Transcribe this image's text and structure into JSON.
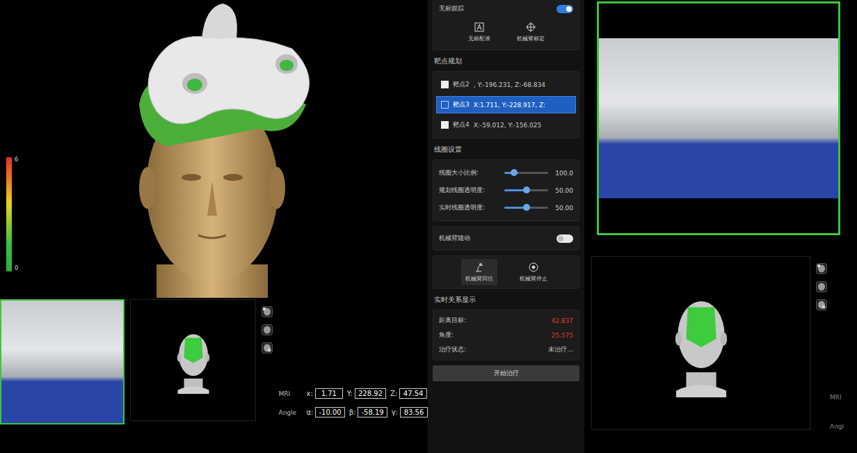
{
  "legend": {
    "max": "6",
    "min": "0"
  },
  "camera_left": {
    "active": true
  },
  "coords": [
    {
      "label": "MRI",
      "fields": [
        {
          "axis": "x:",
          "value": "1.71"
        },
        {
          "axis": "Y:",
          "value": "228.92"
        },
        {
          "axis": "Z:",
          "value": "47.54"
        }
      ]
    },
    {
      "label": "Angle",
      "fields": [
        {
          "axis": "α:",
          "value": "-10.00"
        },
        {
          "axis": "β:",
          "value": "-58.19"
        },
        {
          "axis": "γ:",
          "value": "83.56"
        }
      ]
    }
  ],
  "panel": {
    "tracking": {
      "label": "无标跟踪",
      "on": true
    },
    "tracking_buttons": [
      "无标配准",
      "机械臂标定"
    ],
    "targets_title": "靶点规划",
    "targets": [
      {
        "name": "靶点2",
        "coords": ",    Y:-196.231,   Z:-68.834",
        "selected": false
      },
      {
        "name": "靶点3",
        "coords": "X:1.711,    Y:-228.917,   Z:",
        "selected": true
      },
      {
        "name": "靶点4",
        "coords": "X:-59.012,    Y:-156.025",
        "selected": false
      }
    ],
    "coil_title": "线圈设置",
    "sliders": [
      {
        "label": "线圈大小比例:",
        "value": "100.0",
        "level": 0.22
      },
      {
        "label": "规划线圈透明度:",
        "value": "50.00",
        "level": 0.5
      },
      {
        "label": "实时线圈透明度:",
        "value": "50.00",
        "level": 0.5
      }
    ],
    "follow": {
      "label": "机械臂随动",
      "on": false
    },
    "arm_buttons": [
      {
        "label": "机械臂回位",
        "selected": true
      },
      {
        "label": "机械臂停止",
        "selected": false
      }
    ],
    "relation_title": "实时关系显示",
    "relations": [
      {
        "label": "距离目标:",
        "value": "42.837",
        "alert": true
      },
      {
        "label": "角度:",
        "value": "25.575",
        "alert": true
      },
      {
        "label": "治疗状态:",
        "value": "未治疗...",
        "alert": false
      }
    ],
    "start_button": "开始治疗"
  },
  "camera_right": {
    "active": true
  },
  "right_labels": [
    "MRI",
    "Angl"
  ]
}
